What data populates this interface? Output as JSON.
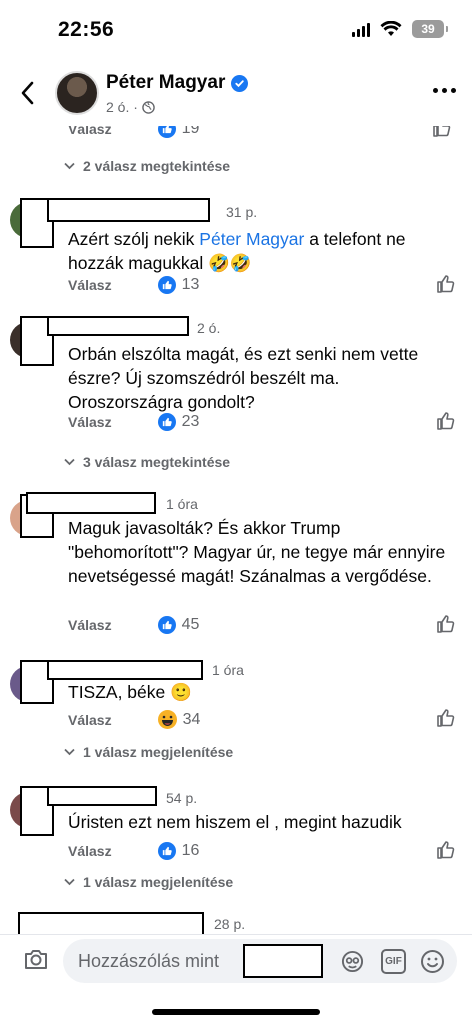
{
  "status": {
    "time": "22:56",
    "battery": "39"
  },
  "header": {
    "name": "Péter Magyar",
    "meta": "2 ó. ·"
  },
  "partial_top": {
    "reply": "Válasz",
    "likes": "19"
  },
  "comments": [
    {
      "time": "31 p.",
      "text_before": "Azért szólj nekik ",
      "mention": "Péter Magyar",
      "text_after": " a telefont ne hozzák magukkal 🤣🤣",
      "reply": "Válasz",
      "likes": "13",
      "reaction": "like"
    },
    {
      "time": "2 ó.",
      "text": "Orbán elszólta magát, és ezt senki nem vette észre? Új szomszédról beszélt ma. Oroszországra gondolt?",
      "reply": "Válasz",
      "likes": "23",
      "reaction": "like"
    },
    {
      "time": "1 óra",
      "text": "Maguk javasolták? És akkor Trump \"behomorított\"? Magyar úr, ne tegye már ennyire nevetségessé magát! Szánalmas a vergődése.",
      "reply": "Válasz",
      "likes": "45",
      "reaction": "like"
    },
    {
      "time": "1 óra",
      "text": "TISZA, béke 🙂",
      "reply": "Válasz",
      "likes": "34",
      "reaction": "haha"
    },
    {
      "time": "54 p.",
      "text": "Úristen ezt nem hiszem el , megint hazudik",
      "reply": "Válasz",
      "likes": "16",
      "reaction": "like"
    }
  ],
  "view_replies": [
    "2 válasz megtekintése",
    "3 válasz megtekintése",
    "1 válasz megjelenítése",
    "1 válasz megjelenítése"
  ],
  "partial_bottom": {
    "time": "28 p."
  },
  "composer": {
    "placeholder": "Hozzászólás mint",
    "gif": "GIF"
  },
  "colors": {
    "link": "#1b74e4",
    "like": "#1877f2",
    "muted": "#65676b"
  }
}
